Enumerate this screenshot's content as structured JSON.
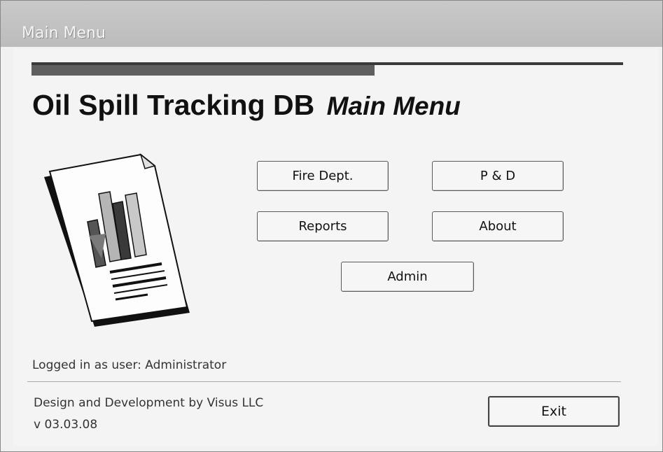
{
  "window": {
    "title": "Main Menu"
  },
  "header": {
    "app_name": "Oil Spill Tracking DB",
    "subtitle": "Main Menu"
  },
  "buttons": {
    "fire_dept": "Fire Dept.",
    "pd": "P & D",
    "reports": "Reports",
    "about": "About",
    "admin": "Admin",
    "exit": "Exit"
  },
  "icon": {
    "name": "report-document-icon"
  },
  "footer": {
    "status": "Logged in as user: Administrator",
    "credit": "Design and Development by Visus LLC",
    "version": "v 03.03.08"
  }
}
